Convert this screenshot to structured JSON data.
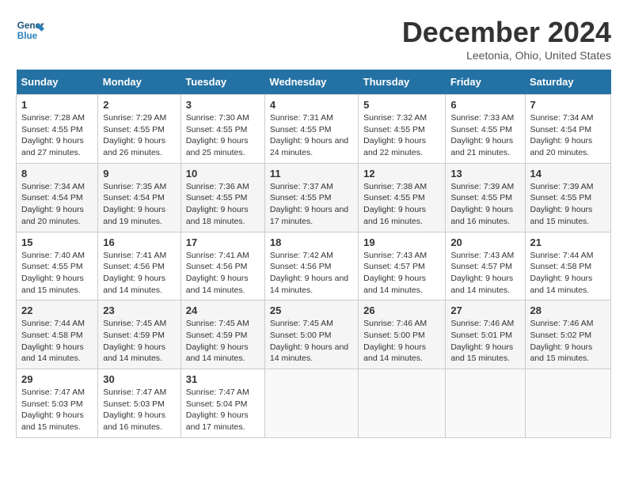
{
  "header": {
    "logo_line1": "General",
    "logo_line2": "Blue",
    "month": "December 2024",
    "location": "Leetonia, Ohio, United States"
  },
  "weekdays": [
    "Sunday",
    "Monday",
    "Tuesday",
    "Wednesday",
    "Thursday",
    "Friday",
    "Saturday"
  ],
  "weeks": [
    [
      {
        "day": "1",
        "sunrise": "Sunrise: 7:28 AM",
        "sunset": "Sunset: 4:55 PM",
        "daylight": "Daylight: 9 hours and 27 minutes."
      },
      {
        "day": "2",
        "sunrise": "Sunrise: 7:29 AM",
        "sunset": "Sunset: 4:55 PM",
        "daylight": "Daylight: 9 hours and 26 minutes."
      },
      {
        "day": "3",
        "sunrise": "Sunrise: 7:30 AM",
        "sunset": "Sunset: 4:55 PM",
        "daylight": "Daylight: 9 hours and 25 minutes."
      },
      {
        "day": "4",
        "sunrise": "Sunrise: 7:31 AM",
        "sunset": "Sunset: 4:55 PM",
        "daylight": "Daylight: 9 hours and 24 minutes."
      },
      {
        "day": "5",
        "sunrise": "Sunrise: 7:32 AM",
        "sunset": "Sunset: 4:55 PM",
        "daylight": "Daylight: 9 hours and 22 minutes."
      },
      {
        "day": "6",
        "sunrise": "Sunrise: 7:33 AM",
        "sunset": "Sunset: 4:55 PM",
        "daylight": "Daylight: 9 hours and 21 minutes."
      },
      {
        "day": "7",
        "sunrise": "Sunrise: 7:34 AM",
        "sunset": "Sunset: 4:54 PM",
        "daylight": "Daylight: 9 hours and 20 minutes."
      }
    ],
    [
      {
        "day": "8",
        "sunrise": "Sunrise: 7:34 AM",
        "sunset": "Sunset: 4:54 PM",
        "daylight": "Daylight: 9 hours and 20 minutes."
      },
      {
        "day": "9",
        "sunrise": "Sunrise: 7:35 AM",
        "sunset": "Sunset: 4:54 PM",
        "daylight": "Daylight: 9 hours and 19 minutes."
      },
      {
        "day": "10",
        "sunrise": "Sunrise: 7:36 AM",
        "sunset": "Sunset: 4:55 PM",
        "daylight": "Daylight: 9 hours and 18 minutes."
      },
      {
        "day": "11",
        "sunrise": "Sunrise: 7:37 AM",
        "sunset": "Sunset: 4:55 PM",
        "daylight": "Daylight: 9 hours and 17 minutes."
      },
      {
        "day": "12",
        "sunrise": "Sunrise: 7:38 AM",
        "sunset": "Sunset: 4:55 PM",
        "daylight": "Daylight: 9 hours and 16 minutes."
      },
      {
        "day": "13",
        "sunrise": "Sunrise: 7:39 AM",
        "sunset": "Sunset: 4:55 PM",
        "daylight": "Daylight: 9 hours and 16 minutes."
      },
      {
        "day": "14",
        "sunrise": "Sunrise: 7:39 AM",
        "sunset": "Sunset: 4:55 PM",
        "daylight": "Daylight: 9 hours and 15 minutes."
      }
    ],
    [
      {
        "day": "15",
        "sunrise": "Sunrise: 7:40 AM",
        "sunset": "Sunset: 4:55 PM",
        "daylight": "Daylight: 9 hours and 15 minutes."
      },
      {
        "day": "16",
        "sunrise": "Sunrise: 7:41 AM",
        "sunset": "Sunset: 4:56 PM",
        "daylight": "Daylight: 9 hours and 14 minutes."
      },
      {
        "day": "17",
        "sunrise": "Sunrise: 7:41 AM",
        "sunset": "Sunset: 4:56 PM",
        "daylight": "Daylight: 9 hours and 14 minutes."
      },
      {
        "day": "18",
        "sunrise": "Sunrise: 7:42 AM",
        "sunset": "Sunset: 4:56 PM",
        "daylight": "Daylight: 9 hours and 14 minutes."
      },
      {
        "day": "19",
        "sunrise": "Sunrise: 7:43 AM",
        "sunset": "Sunset: 4:57 PM",
        "daylight": "Daylight: 9 hours and 14 minutes."
      },
      {
        "day": "20",
        "sunrise": "Sunrise: 7:43 AM",
        "sunset": "Sunset: 4:57 PM",
        "daylight": "Daylight: 9 hours and 14 minutes."
      },
      {
        "day": "21",
        "sunrise": "Sunrise: 7:44 AM",
        "sunset": "Sunset: 4:58 PM",
        "daylight": "Daylight: 9 hours and 14 minutes."
      }
    ],
    [
      {
        "day": "22",
        "sunrise": "Sunrise: 7:44 AM",
        "sunset": "Sunset: 4:58 PM",
        "daylight": "Daylight: 9 hours and 14 minutes."
      },
      {
        "day": "23",
        "sunrise": "Sunrise: 7:45 AM",
        "sunset": "Sunset: 4:59 PM",
        "daylight": "Daylight: 9 hours and 14 minutes."
      },
      {
        "day": "24",
        "sunrise": "Sunrise: 7:45 AM",
        "sunset": "Sunset: 4:59 PM",
        "daylight": "Daylight: 9 hours and 14 minutes."
      },
      {
        "day": "25",
        "sunrise": "Sunrise: 7:45 AM",
        "sunset": "Sunset: 5:00 PM",
        "daylight": "Daylight: 9 hours and 14 minutes."
      },
      {
        "day": "26",
        "sunrise": "Sunrise: 7:46 AM",
        "sunset": "Sunset: 5:00 PM",
        "daylight": "Daylight: 9 hours and 14 minutes."
      },
      {
        "day": "27",
        "sunrise": "Sunrise: 7:46 AM",
        "sunset": "Sunset: 5:01 PM",
        "daylight": "Daylight: 9 hours and 15 minutes."
      },
      {
        "day": "28",
        "sunrise": "Sunrise: 7:46 AM",
        "sunset": "Sunset: 5:02 PM",
        "daylight": "Daylight: 9 hours and 15 minutes."
      }
    ],
    [
      {
        "day": "29",
        "sunrise": "Sunrise: 7:47 AM",
        "sunset": "Sunset: 5:03 PM",
        "daylight": "Daylight: 9 hours and 15 minutes."
      },
      {
        "day": "30",
        "sunrise": "Sunrise: 7:47 AM",
        "sunset": "Sunset: 5:03 PM",
        "daylight": "Daylight: 9 hours and 16 minutes."
      },
      {
        "day": "31",
        "sunrise": "Sunrise: 7:47 AM",
        "sunset": "Sunset: 5:04 PM",
        "daylight": "Daylight: 9 hours and 17 minutes."
      },
      null,
      null,
      null,
      null
    ]
  ]
}
